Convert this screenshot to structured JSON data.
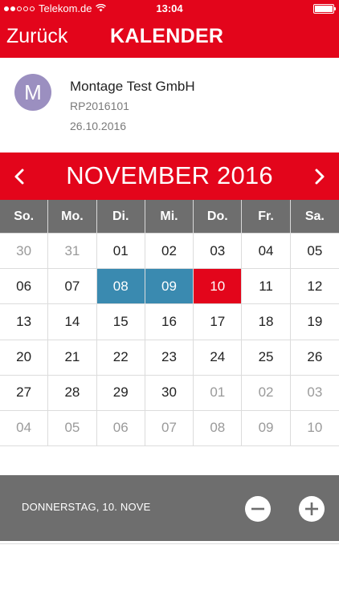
{
  "status_bar": {
    "carrier": "Telekom.de",
    "time": "13:04"
  },
  "nav": {
    "back_label": "Zurück",
    "title": "KALENDER"
  },
  "customer": {
    "avatar_initial": "M",
    "name": "Montage Test GmbH",
    "id": "RP2016101",
    "date": "26.10.2016"
  },
  "calendar": {
    "month_label": "NOVEMBER 2016",
    "weekdays": [
      "So.",
      "Mo.",
      "Di.",
      "Mi.",
      "Do.",
      "Fr.",
      "Sa."
    ],
    "days": [
      {
        "label": "30",
        "state": "muted"
      },
      {
        "label": "31",
        "state": "muted"
      },
      {
        "label": "01",
        "state": "normal"
      },
      {
        "label": "02",
        "state": "normal"
      },
      {
        "label": "03",
        "state": "normal"
      },
      {
        "label": "04",
        "state": "normal"
      },
      {
        "label": "05",
        "state": "normal"
      },
      {
        "label": "06",
        "state": "normal"
      },
      {
        "label": "07",
        "state": "normal"
      },
      {
        "label": "08",
        "state": "selected"
      },
      {
        "label": "09",
        "state": "selected"
      },
      {
        "label": "10",
        "state": "today"
      },
      {
        "label": "11",
        "state": "normal"
      },
      {
        "label": "12",
        "state": "normal"
      },
      {
        "label": "13",
        "state": "normal"
      },
      {
        "label": "14",
        "state": "normal"
      },
      {
        "label": "15",
        "state": "normal"
      },
      {
        "label": "16",
        "state": "normal"
      },
      {
        "label": "17",
        "state": "normal"
      },
      {
        "label": "18",
        "state": "normal"
      },
      {
        "label": "19",
        "state": "normal"
      },
      {
        "label": "20",
        "state": "normal"
      },
      {
        "label": "21",
        "state": "normal"
      },
      {
        "label": "22",
        "state": "normal"
      },
      {
        "label": "23",
        "state": "normal"
      },
      {
        "label": "24",
        "state": "normal"
      },
      {
        "label": "25",
        "state": "normal"
      },
      {
        "label": "26",
        "state": "normal"
      },
      {
        "label": "27",
        "state": "normal"
      },
      {
        "label": "28",
        "state": "normal"
      },
      {
        "label": "29",
        "state": "normal"
      },
      {
        "label": "30",
        "state": "normal"
      },
      {
        "label": "01",
        "state": "muted"
      },
      {
        "label": "02",
        "state": "muted"
      },
      {
        "label": "03",
        "state": "muted"
      },
      {
        "label": "04",
        "state": "muted"
      },
      {
        "label": "05",
        "state": "muted"
      },
      {
        "label": "06",
        "state": "muted"
      },
      {
        "label": "07",
        "state": "muted"
      },
      {
        "label": "08",
        "state": "muted"
      },
      {
        "label": "09",
        "state": "muted"
      },
      {
        "label": "10",
        "state": "muted"
      }
    ]
  },
  "day_bar": {
    "label": "DONNERSTAG, 10. NOVE"
  },
  "colors": {
    "brand_red": "#e3051b",
    "selected_blue": "#3a8ab0",
    "header_gray": "#6e6e6e",
    "avatar_purple": "#9b8fc0"
  },
  "icons": {
    "prev": "chevron-left-icon",
    "next": "chevron-right-icon",
    "minus": "minus-circle-icon",
    "plus": "plus-circle-icon"
  }
}
